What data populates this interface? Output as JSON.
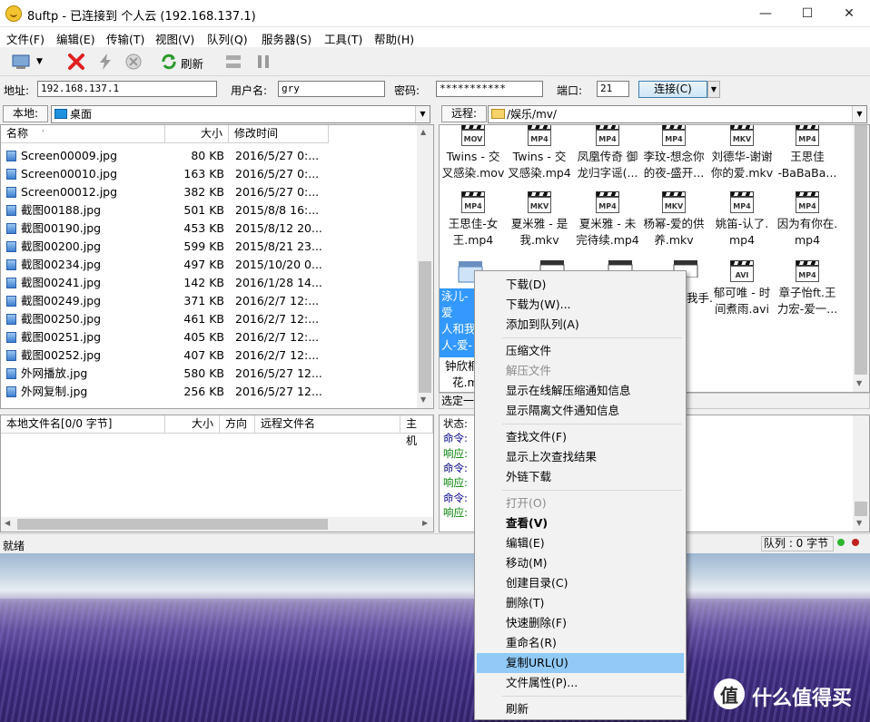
{
  "window": {
    "title": "8uftp - 已连接到 个人云 (192.168.137.1)",
    "min": "—",
    "max": "☐",
    "close": "✕"
  },
  "menu": [
    "文件(F)",
    "编辑(E)",
    "传输(T)",
    "视图(V)",
    "队列(Q)",
    "服务器(S)",
    "工具(T)",
    "帮助(H)"
  ],
  "toolbar": {
    "refresh_label": "刷新"
  },
  "connect": {
    "addr_label": "地址:",
    "addr_value": "192.168.137.1",
    "user_label": "用户名:",
    "user_value": "gry",
    "pass_label": "密码:",
    "pass_value": "***********",
    "port_label": "端口:",
    "port_value": "21",
    "connect_label": "连接(C)"
  },
  "local": {
    "label": "本地:",
    "path": "桌面",
    "headers": [
      "名称",
      "大小",
      "修改时间"
    ],
    "files": [
      {
        "name": "Screen00009.jpg",
        "size": "80 KB",
        "date": "2016/5/27 0:..."
      },
      {
        "name": "Screen00010.jpg",
        "size": "163 KB",
        "date": "2016/5/27 0:..."
      },
      {
        "name": "Screen00012.jpg",
        "size": "382 KB",
        "date": "2016/5/27 0:..."
      },
      {
        "name": "截图00188.jpg",
        "size": "501 KB",
        "date": "2015/8/8 16:..."
      },
      {
        "name": "截图00190.jpg",
        "size": "453 KB",
        "date": "2015/8/12 20..."
      },
      {
        "name": "截图00200.jpg",
        "size": "599 KB",
        "date": "2015/8/21 23..."
      },
      {
        "name": "截图00234.jpg",
        "size": "497 KB",
        "date": "2015/10/20 0..."
      },
      {
        "name": "截图00241.jpg",
        "size": "142 KB",
        "date": "2016/1/28 14..."
      },
      {
        "name": "截图00249.jpg",
        "size": "371 KB",
        "date": "2016/2/7 12:..."
      },
      {
        "name": "截图00250.jpg",
        "size": "461 KB",
        "date": "2016/2/7 12:..."
      },
      {
        "name": "截图00251.jpg",
        "size": "405 KB",
        "date": "2016/2/7 12:..."
      },
      {
        "name": "截图00252.jpg",
        "size": "407 KB",
        "date": "2016/2/7 12:..."
      },
      {
        "name": "外网播放.jpg",
        "size": "580 KB",
        "date": "2016/5/27 12..."
      },
      {
        "name": "外网复制.jpg",
        "size": "256 KB",
        "date": "2016/5/27 12..."
      }
    ]
  },
  "remote": {
    "label": "远程:",
    "path": "/娱乐/mv/",
    "items": [
      {
        "fmt": "MOV",
        "l1": "Twins - 交",
        "l2": "叉感染.mov"
      },
      {
        "fmt": "MP4",
        "l1": "Twins - 交",
        "l2": "叉感染.mp4"
      },
      {
        "fmt": "MP4",
        "l1": "凤凰传奇 御",
        "l2": "龙归字谣(..."
      },
      {
        "fmt": "MP4",
        "l1": "李玟-想念你",
        "l2": "的夜-盛开..."
      },
      {
        "fmt": "MKV",
        "l1": "刘德华-谢谢",
        "l2": "你的爱.mkv"
      },
      {
        "fmt": "MP4",
        "l1": "王思佳",
        "l2": "-BaBaBa..."
      },
      {
        "fmt": "MP4",
        "l1": "王思佳-女",
        "l2": "王.mp4"
      },
      {
        "fmt": "MKV",
        "l1": "夏米雅 - 是",
        "l2": "我.mkv"
      },
      {
        "fmt": "MP4",
        "l1": "夏米雅 - 未",
        "l2": "完待续.mp4"
      },
      {
        "fmt": "MKV",
        "l1": "杨幂-爱的供",
        "l2": "养.mkv"
      },
      {
        "fmt": "MP4",
        "l1": "姚笛-认了.",
        "l2": "mp4"
      },
      {
        "fmt": "MP4",
        "l1": "因为有你在.",
        "l2": "mp4"
      },
      {
        "fmt": "AVI",
        "l1": "郁可唯 - 时",
        "l2": "间煮雨.avi"
      },
      {
        "fmt": "MP4",
        "l1": "章子怡ft.王",
        "l2": "力宏-爱一..."
      }
    ],
    "sel_lines": [
      "泳儿-爱",
      "人和我",
      "人-爱-",
      "mp"
    ],
    "partial_wo": "我手.",
    "partial_zhong_1": "钟欣桐",
    "partial_zhong_2": "花.m",
    "status_left": "选定一"
  },
  "queue": {
    "headers": [
      "本地文件名[0/0 字节]",
      "大小",
      "方向",
      "远程文件名",
      "主机"
    ]
  },
  "log": [
    {
      "k": "状态:",
      "c": "#000"
    },
    {
      "k": "命令:",
      "c": "#00008b"
    },
    {
      "k": "响应:",
      "c": "#008000"
    },
    {
      "k": "命令:",
      "c": "#00008b"
    },
    {
      "k": "响应:",
      "c": "#008000"
    },
    {
      "k": "命令:",
      "c": "#00008b"
    },
    {
      "k": "响应:",
      "c": "#008000"
    }
  ],
  "status": {
    "left": "就绪",
    "queue": "队列 : 0 字节"
  },
  "context_menu": [
    {
      "label": "下载(D)"
    },
    {
      "label": "下载为(W)..."
    },
    {
      "label": "添加到队列(A)"
    },
    {
      "sep": true
    },
    {
      "label": "压缩文件"
    },
    {
      "label": "解压文件",
      "disabled": true
    },
    {
      "label": "显示在线解压缩通知信息"
    },
    {
      "label": "显示隔离文件通知信息"
    },
    {
      "sep": true
    },
    {
      "label": "查找文件(F)"
    },
    {
      "label": "显示上次查找结果"
    },
    {
      "label": "外链下载"
    },
    {
      "sep": true
    },
    {
      "label": "打开(O)",
      "disabled": true
    },
    {
      "label": "查看(V)",
      "bold": true
    },
    {
      "label": "编辑(E)"
    },
    {
      "label": "移动(M)"
    },
    {
      "label": "创建目录(C)"
    },
    {
      "label": "删除(T)"
    },
    {
      "label": "快速删除(F)"
    },
    {
      "label": "重命名(R)"
    },
    {
      "label": "复制URL(U)",
      "highlight": true
    },
    {
      "label": "文件属性(P)..."
    },
    {
      "sep": true
    },
    {
      "label": "刷新"
    }
  ],
  "watermark": {
    "logo": "值",
    "text": "什么值得买"
  },
  "colors": {
    "selection": "#3399ff",
    "menu_highlight": "#91c9f7",
    "accent": "#0078d7"
  }
}
